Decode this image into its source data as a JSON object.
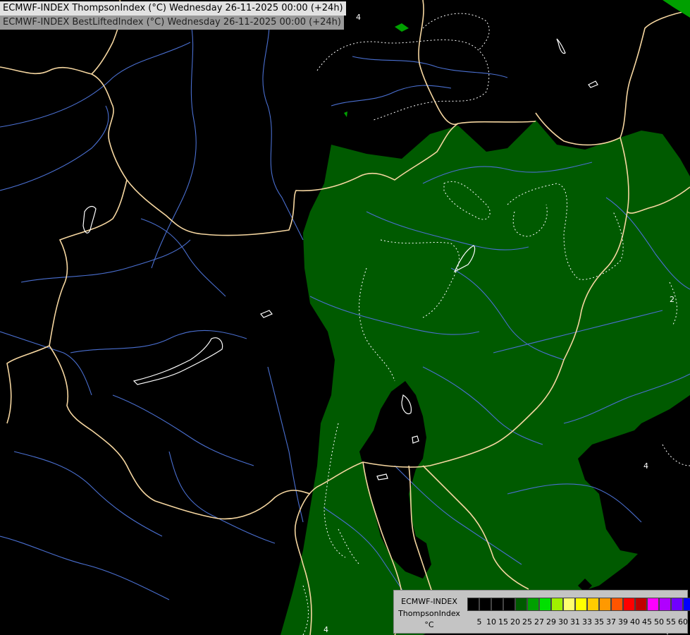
{
  "header": {
    "line1": "ECMWF-INDEX ThompsonIndex (°C) Wednesday 26-11-2025 00:00 (+24h)",
    "line2": "ECMWF-INDEX BestLiftedIndex (°C) Wednesday 26-11-2025 00:00 (+24h)"
  },
  "colors": {
    "background": "#000000",
    "field_fill": "#005a00",
    "border": "#f5d6a0",
    "river": "#4a6fd0",
    "contour": "#ffffff"
  },
  "contour_labels": [
    "4",
    "2",
    "4",
    "2",
    "4"
  ],
  "legend": {
    "title1": "ECMWF-INDEX",
    "title2": "ThompsonIndex",
    "unit": "°C",
    "ticks": [
      "5",
      "10",
      "15",
      "20",
      "25",
      "27",
      "29",
      "30",
      "31",
      "33",
      "35",
      "37",
      "39",
      "40",
      "45",
      "50",
      "55",
      "60"
    ],
    "swatches": [
      "#000000",
      "#000000",
      "#000000",
      "#000000",
      "#005a00",
      "#00a000",
      "#00e000",
      "#a0f000",
      "#ffff70",
      "#ffff00",
      "#ffcc00",
      "#ff9900",
      "#ff5500",
      "#ff0000",
      "#c00000",
      "#ff00ff",
      "#b000ff",
      "#7000ff",
      "#0000ff"
    ]
  }
}
